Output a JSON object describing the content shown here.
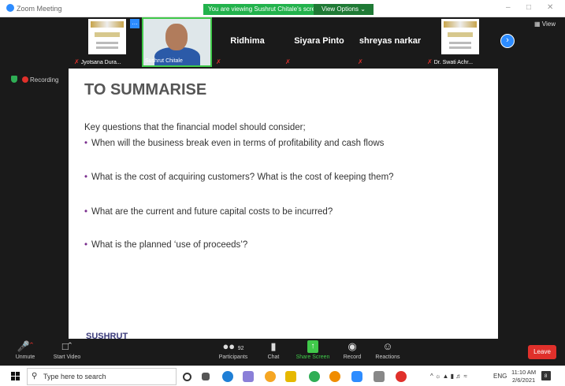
{
  "window": {
    "title": "Zoom Meeting",
    "banner": "You are viewing Sushrut Chitale's screen",
    "view_options": "View Options ⌄",
    "controls": [
      "–",
      "□",
      "✕"
    ],
    "view_label": "View"
  },
  "participants": [
    {
      "name": "Jyotsana Dura...",
      "kind": "thumb"
    },
    {
      "name": "Sushrut Chitale",
      "kind": "speaker"
    },
    {
      "name": "Ridhima",
      "kind": "name"
    },
    {
      "name": "Siyara Pinto",
      "kind": "name"
    },
    {
      "name": "shreyas narkar",
      "kind": "name"
    },
    {
      "name": "Dr. Swati Achr...",
      "kind": "thumb"
    }
  ],
  "recording": {
    "label": "Recording"
  },
  "slide": {
    "title": "TO SUMMARISE",
    "intro": "Key questions that the financial model should consider;",
    "bullets": [
      "When will the business break even in terms of profitability and cash flows",
      "What is the cost of acquiring customers? What is the cost of keeping them?",
      "What are the current and future capital costs to be incurred?",
      "What is the planned ‘use of proceeds’?"
    ],
    "cutoff_text": "SUSHRUT"
  },
  "toolbar": {
    "unmute": "Unmute",
    "start_video": "Start Video",
    "participants": "Participants",
    "participant_count": "92",
    "chat": "Chat",
    "share_screen": "Share Screen",
    "record": "Record",
    "reactions": "Reactions",
    "leave": "Leave"
  },
  "taskbar": {
    "search_placeholder": "Type here to search",
    "language": "ENG",
    "time": "11:10 AM",
    "date": "2/6/2021",
    "notification_count": "8"
  }
}
